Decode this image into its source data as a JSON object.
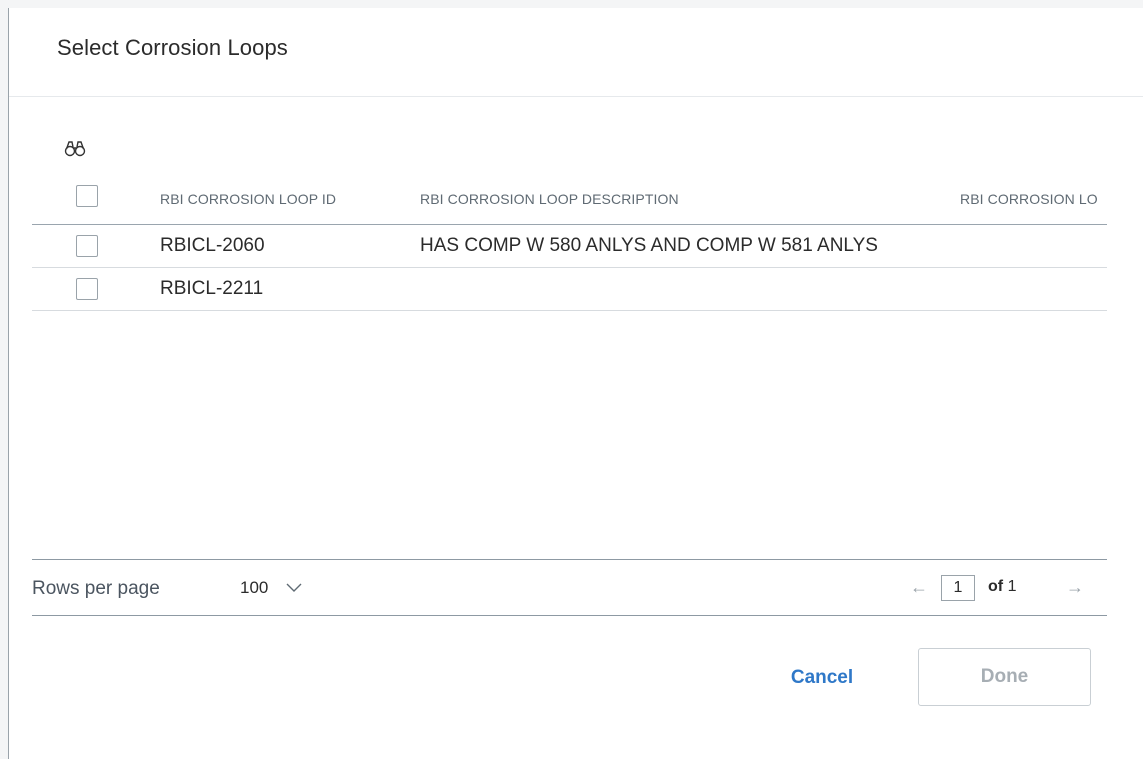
{
  "dialog": {
    "title": "Select Corrosion Loops"
  },
  "toolbar": {
    "search_icon": "binoculars-icon"
  },
  "table": {
    "columns": [
      "RBI CORROSION LOOP ID",
      "RBI CORROSION LOOP DESCRIPTION",
      "RBI CORROSION LO"
    ],
    "rows": [
      {
        "id": "RBICL-2060",
        "description": "HAS COMP W 580 ANLYS AND COMP W 581 ANLYS",
        "extra": ""
      },
      {
        "id": "RBICL-2211",
        "description": "",
        "extra": ""
      }
    ]
  },
  "pagination": {
    "rows_per_page_label": "Rows per page",
    "rows_per_page_value": "100",
    "current_page": "1",
    "of_label": "of",
    "total_pages": "1"
  },
  "buttons": {
    "cancel": "Cancel",
    "done": "Done"
  },
  "colors": {
    "accent": "#2f78c8",
    "disabled": "#a7aeb4"
  }
}
